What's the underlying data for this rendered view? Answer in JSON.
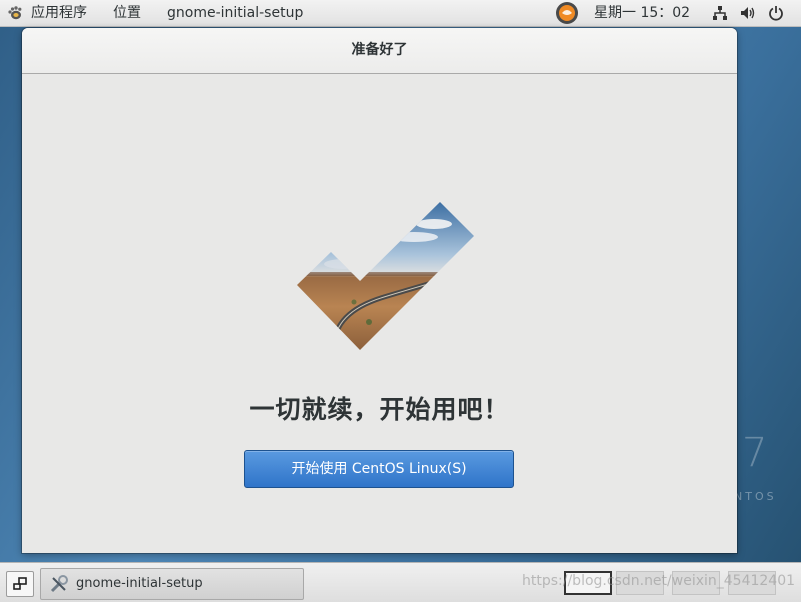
{
  "topbar": {
    "applications_label": "应用程序",
    "places_label": "位置",
    "active_app_label": "gnome-initial-setup",
    "clock": "星期一 15：02"
  },
  "desktop": {
    "brand_number": "7",
    "brand_word": "NTOS"
  },
  "window": {
    "title": "准备好了",
    "heading": "一切就续，开始用吧！",
    "start_button_label": "开始使用 CentOS Linux(S)"
  },
  "taskbar": {
    "task_label": "gnome-initial-setup",
    "watermark": "https://blog.csdn.net/weixin_45412401"
  },
  "colors": {
    "accent": "#3a82d6",
    "window_bg": "#e8e8e7"
  },
  "icons": [
    "gnome-foot-icon",
    "notification-icon",
    "network-icon",
    "volume-icon",
    "power-icon",
    "show-desktop-icon",
    "tools-icon",
    "checkmark-image"
  ]
}
